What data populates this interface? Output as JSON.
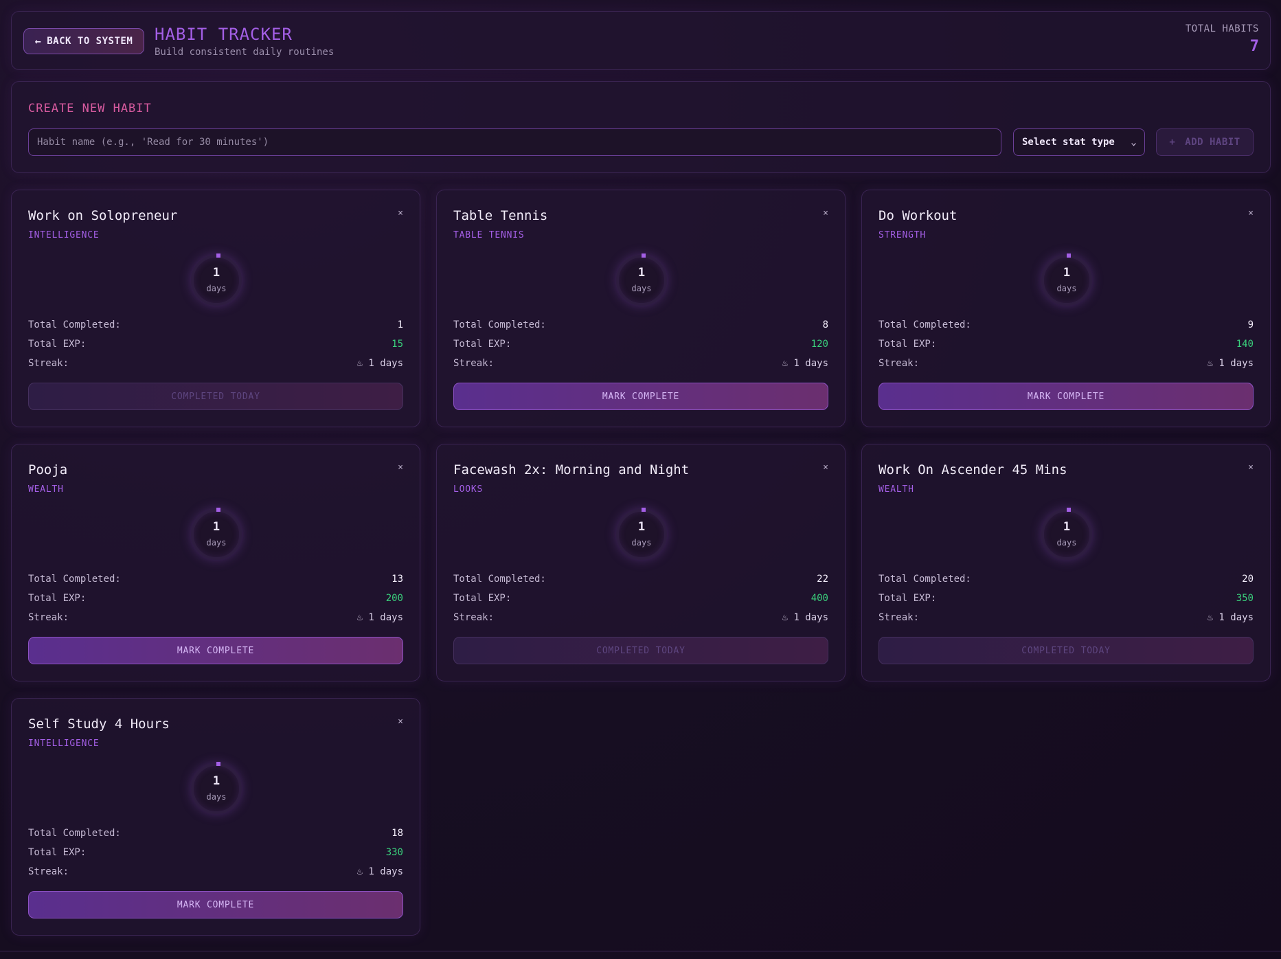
{
  "header": {
    "back_label": "BACK TO SYSTEM",
    "title": "HABIT TRACKER",
    "subtitle": "Build consistent daily routines",
    "total_label": "TOTAL HABITS",
    "total_value": "7"
  },
  "create": {
    "title": "CREATE NEW HABIT",
    "input_placeholder": "Habit name (e.g., 'Read for 30 minutes')",
    "input_value": "",
    "select_value": "Select stat type",
    "add_label": "ADD HABIT"
  },
  "labels": {
    "total_completed": "Total Completed:",
    "total_exp": "Total EXP:",
    "streak": "Streak:",
    "days_unit": "days",
    "close": "×"
  },
  "habits": [
    {
      "title": "Work on Solopreneur",
      "stat": "INTELLIGENCE",
      "ring_value": "1",
      "total_completed": "1",
      "total_exp": "15",
      "streak": "1 days",
      "action": "COMPLETED TODAY",
      "done": true
    },
    {
      "title": "Table Tennis",
      "stat": "TABLE TENNIS",
      "ring_value": "1",
      "total_completed": "8",
      "total_exp": "120",
      "streak": "1 days",
      "action": "MARK COMPLETE",
      "done": false
    },
    {
      "title": "Do Workout",
      "stat": "STRENGTH",
      "ring_value": "1",
      "total_completed": "9",
      "total_exp": "140",
      "streak": "1 days",
      "action": "MARK COMPLETE",
      "done": false
    },
    {
      "title": "Pooja",
      "stat": "WEALTH",
      "ring_value": "1",
      "total_completed": "13",
      "total_exp": "200",
      "streak": "1 days",
      "action": "MARK COMPLETE",
      "done": false
    },
    {
      "title": "Facewash 2x: Morning and Night",
      "stat": "LOOKS",
      "ring_value": "1",
      "total_completed": "22",
      "total_exp": "400",
      "streak": "1 days",
      "action": "COMPLETED TODAY",
      "done": true
    },
    {
      "title": "Work On Ascender 45 Mins",
      "stat": "WEALTH",
      "ring_value": "1",
      "total_completed": "20",
      "total_exp": "350",
      "streak": "1 days",
      "action": "COMPLETED TODAY",
      "done": true
    },
    {
      "title": "Self Study 4 Hours",
      "stat": "INTELLIGENCE",
      "ring_value": "1",
      "total_completed": "18",
      "total_exp": "330",
      "streak": "1 days",
      "action": "MARK COMPLETE",
      "done": false
    }
  ],
  "icons": {
    "back": "arrow-left-icon",
    "select": "chevron-down-icon",
    "add": "plus-icon",
    "streak": "flame-icon",
    "close": "close-icon"
  },
  "colors": {
    "accent_purple": "#a45fe6",
    "accent_pink": "#d65a9e",
    "exp_green": "#3ad07c",
    "background": "#170e22"
  }
}
